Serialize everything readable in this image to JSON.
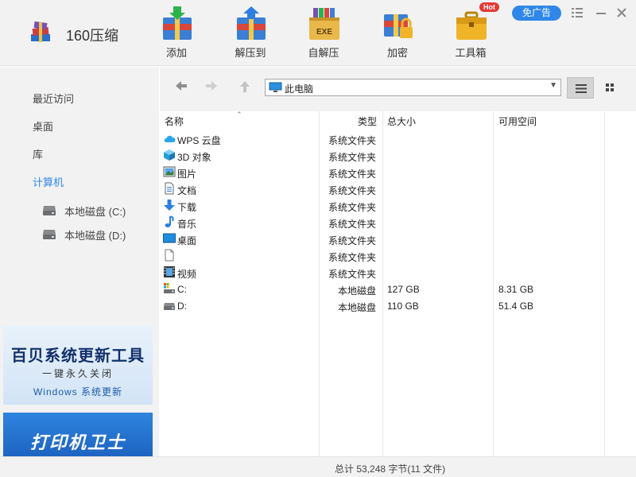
{
  "app": {
    "title": "160压缩",
    "logo_icon": "rar-books-icon"
  },
  "toolbar": {
    "add": "添加",
    "extract": "解压到",
    "sfx": "自解压",
    "sfx_badge": "EXE",
    "encrypt": "加密",
    "toolbox": "工具箱",
    "hot_badge": "Hot",
    "ad_free": "免广告"
  },
  "sidebar": {
    "recent": "最近访问",
    "desktop": "桌面",
    "library": "库",
    "computer": "计算机",
    "drive_c": "本地磁盘 (C:)",
    "drive_d": "本地磁盘 (D:)"
  },
  "ads": {
    "ad1_title": "百贝系统更新工具",
    "ad1_sub": "一键永久关闭",
    "ad1_sub2": "Windows 系统更新",
    "ad2_title": "打印机卫士"
  },
  "nav": {
    "address": "此电脑",
    "back_icon": "back-arrow-icon",
    "forward_icon": "forward-arrow-icon",
    "up_icon": "up-arrow-icon"
  },
  "columns": {
    "name": "名称",
    "type": "类型",
    "size": "总大小",
    "free": "可用空间"
  },
  "files": [
    {
      "name": "WPS 云盘",
      "type": "系统文件夹",
      "size": "",
      "free": "",
      "icon": "cloud-icon"
    },
    {
      "name": "3D 对象",
      "type": "系统文件夹",
      "size": "",
      "free": "",
      "icon": "cube-icon"
    },
    {
      "name": "图片",
      "type": "系统文件夹",
      "size": "",
      "free": "",
      "icon": "pictures-icon"
    },
    {
      "name": "文档",
      "type": "系统文件夹",
      "size": "",
      "free": "",
      "icon": "document-icon"
    },
    {
      "name": "下载",
      "type": "系统文件夹",
      "size": "",
      "free": "",
      "icon": "download-icon"
    },
    {
      "name": "音乐",
      "type": "系统文件夹",
      "size": "",
      "free": "",
      "icon": "music-icon"
    },
    {
      "name": "桌面",
      "type": "系统文件夹",
      "size": "",
      "free": "",
      "icon": "desktop-icon"
    },
    {
      "name": "",
      "type": "系统文件夹",
      "size": "",
      "free": "",
      "icon": "blank-file-icon"
    },
    {
      "name": "视频",
      "type": "系统文件夹",
      "size": "",
      "free": "",
      "icon": "video-icon"
    },
    {
      "name": "C:",
      "type": "本地磁盘",
      "size": "127 GB",
      "free": "8.31 GB",
      "icon": "system-drive-icon"
    },
    {
      "name": "D:",
      "type": "本地磁盘",
      "size": "110 GB",
      "free": "51.4 GB",
      "icon": "drive-icon"
    }
  ],
  "status": {
    "text": "总计  53,248 字节(11 文件)"
  },
  "colors": {
    "accent": "#2f87e8",
    "hot": "#e53935",
    "panel": "#f2f2f2"
  }
}
